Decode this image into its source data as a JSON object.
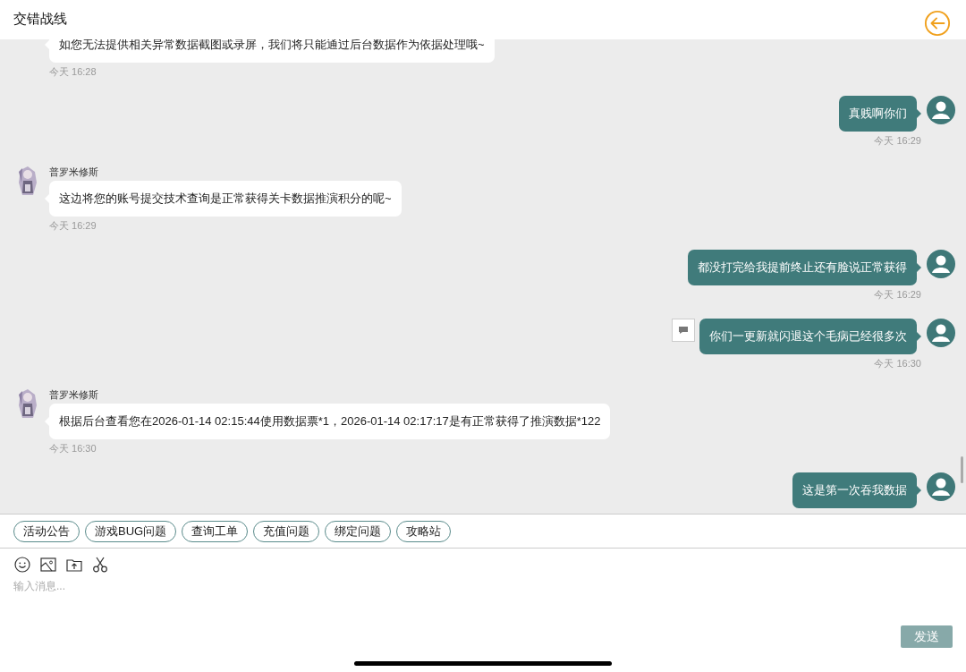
{
  "header": {
    "title": "交错战线"
  },
  "messages": [
    {
      "kind": "agent",
      "text": "如您无法提供相关异常数据截图或录屏，我们将只能通过后台数据作为依据处理哦~",
      "time": "今天 16:28",
      "menu_icon": false
    },
    {
      "kind": "user",
      "text": "真贱啊你们",
      "time": "今天 16:29",
      "menu_icon": false
    },
    {
      "kind": "agent",
      "sender": "普罗米修斯",
      "text": "这边将您的账号提交技术查询是正常获得关卡数据推演积分的呢~",
      "time": "今天 16:29",
      "menu_icon": false
    },
    {
      "kind": "user",
      "text": "都没打完给我提前终止还有脸说正常获得",
      "time": "今天 16:29",
      "menu_icon": false
    },
    {
      "kind": "user",
      "text": "你们一更新就闪退这个毛病已经很多次",
      "time": "今天 16:30",
      "menu_icon": true
    },
    {
      "kind": "agent",
      "sender": "普罗米修斯",
      "text": "根据后台查看您在2026-01-14 02:15:44使用数据票*1，2026-01-14 02:17:17是有正常获得了推演数据*122",
      "time": "今天 16:30",
      "menu_icon": false
    },
    {
      "kind": "user",
      "text": "这是第一次吞我数据",
      "menu_icon": false
    }
  ],
  "quick_replies": [
    "活动公告",
    "游戏BUG问题",
    "查询工单",
    "充值问题",
    "绑定问题",
    "攻略站"
  ],
  "composer": {
    "placeholder": "输入消息...",
    "send_button": "发送"
  }
}
